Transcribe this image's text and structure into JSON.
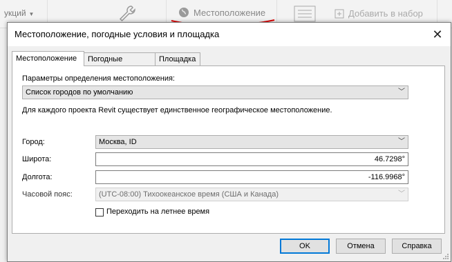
{
  "ribbon": {
    "left_label": "укций",
    "location_label": "Местоположение",
    "add_to_set_label": "Добавить в набор"
  },
  "dialog": {
    "title": "Местоположение, погодные условия и площадка",
    "close_glyph": "✕",
    "tabs": [
      {
        "label": "Местоположение",
        "active": true
      },
      {
        "label": "Погодные условия",
        "active": false
      },
      {
        "label": "Площадка",
        "active": false
      }
    ],
    "location": {
      "method_label": "Параметры определения местоположения:",
      "method_value": "Список городов по умолчанию",
      "info_text": "Для каждого проекта Revit существует единственное географическое местоположение.",
      "city_label": "Город:",
      "city_value": "Москва, ID",
      "latitude_label": "Широта:",
      "latitude_value": "46.7298°",
      "longitude_label": "Долгота:",
      "longitude_value": "-116.9968°",
      "timezone_label": "Часовой пояс:",
      "timezone_value": "(UTC-08:00) Тихоокеанское время (США и Канада)",
      "dst_label": "Переходить на летнее время",
      "dst_checked": false
    },
    "buttons": {
      "ok": "OK",
      "cancel": "Отмена",
      "help": "Справка"
    }
  },
  "colors": {
    "accent": "#0078d7",
    "annotation_red": "#e00000"
  }
}
